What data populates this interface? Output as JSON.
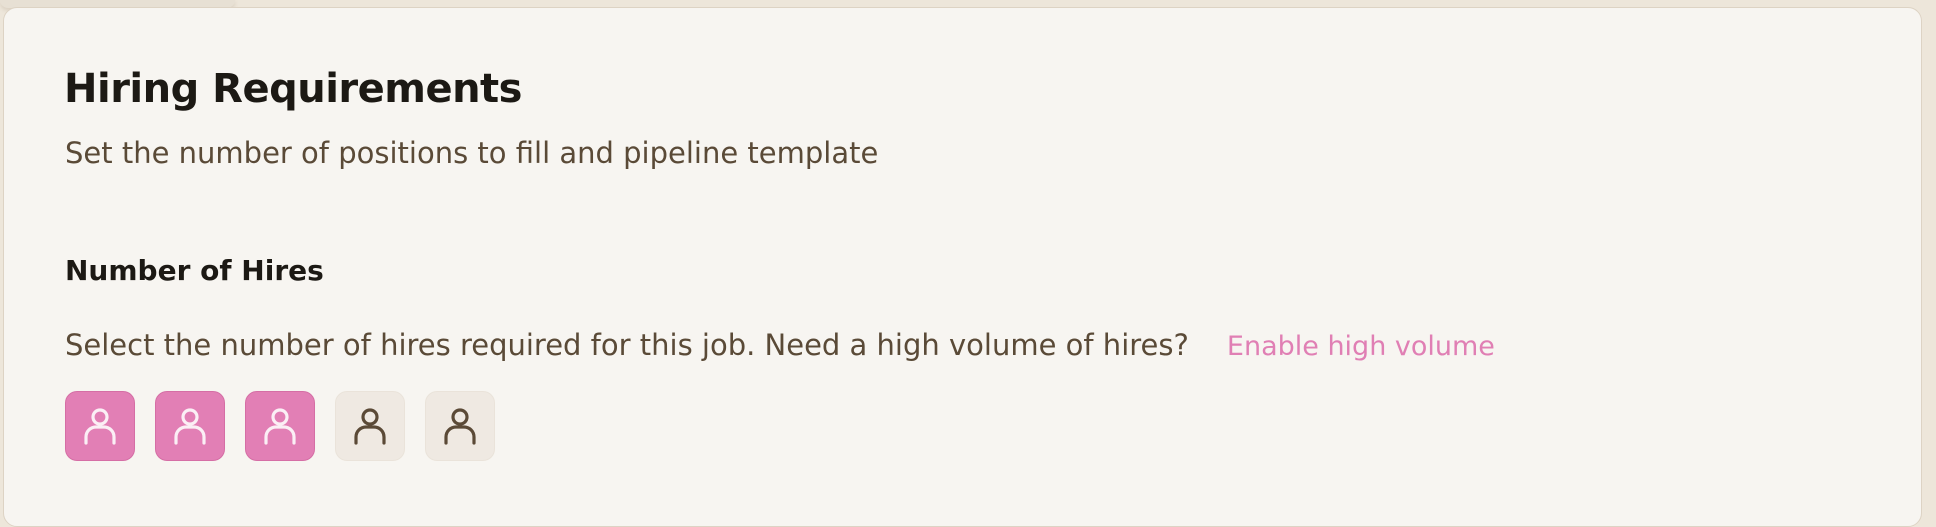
{
  "header": {
    "title": "Hiring Requirements",
    "subtitle": "Set the number of positions to fill and pipeline template"
  },
  "hires": {
    "section_title": "Number of Hires",
    "description": "Select the number of hires required for this job. Need a high volume of hires?",
    "enable_link": "Enable high volume",
    "selected_count": 3,
    "total_options": 5,
    "icon": "user-icon"
  },
  "colors": {
    "accent": "#e27fb5",
    "link": "#e07fb4",
    "unselected_bg": "#efe9e2",
    "card_bg": "#f7f5f1"
  }
}
